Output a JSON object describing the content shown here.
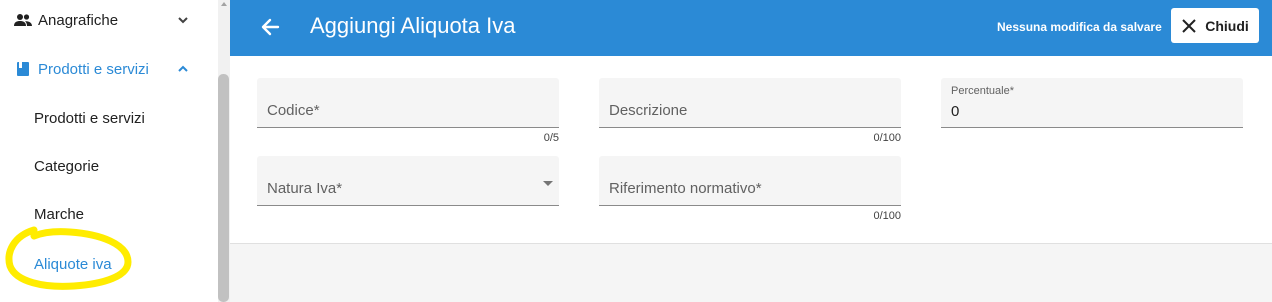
{
  "sidebar": {
    "items": [
      {
        "label": "Anagrafiche",
        "icon": "people-icon"
      },
      {
        "label": "Prodotti e servizi",
        "icon": "book-icon"
      }
    ],
    "subitems": [
      {
        "label": "Prodotti e servizi"
      },
      {
        "label": "Categorie"
      },
      {
        "label": "Marche"
      },
      {
        "label": "Aliquote iva"
      }
    ]
  },
  "header": {
    "title": "Aggiungi Aliquota Iva",
    "status": "Nessuna modifica da salvare",
    "close_label": "Chiudi"
  },
  "form": {
    "codice": {
      "label": "Codice*",
      "counter": "0/5"
    },
    "descrizione": {
      "label": "Descrizione",
      "counter": "0/100"
    },
    "percentuale": {
      "label": "Percentuale*",
      "value": "0"
    },
    "natura": {
      "label": "Natura Iva*"
    },
    "riferimento": {
      "label": "Riferimento normativo*",
      "counter": "0/100"
    }
  },
  "colors": {
    "accent": "#2b8ad6",
    "highlight": "#ffec00"
  }
}
